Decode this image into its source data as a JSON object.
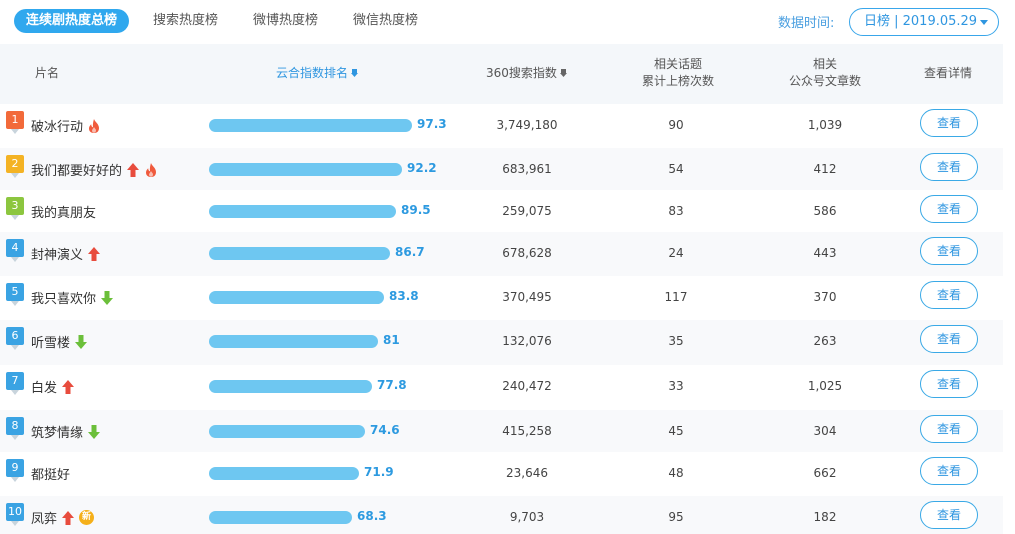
{
  "tabs": [
    {
      "label": "连续剧热度总榜",
      "active": true
    },
    {
      "label": "搜索热度榜",
      "active": false
    },
    {
      "label": "微博热度榜",
      "active": false
    },
    {
      "label": "微信热度榜",
      "active": false
    }
  ],
  "date": {
    "label": "数据时间:",
    "value": "日榜 | 2019.05.29"
  },
  "columns": {
    "title": "片名",
    "cloud_index": "云合指数排名",
    "search_index": "360搜索指数",
    "topics_line1": "相关话题",
    "topics_line2": "累计上榜次数",
    "articles_line1": "相关",
    "articles_line2": "公众号文章数",
    "detail": "查看详情"
  },
  "view_label": "查看",
  "colors": {
    "accent": "#30a8ee",
    "bar": "#6ec7f1",
    "rank1": "#f26a3a",
    "rank2": "#f4b324",
    "rank3": "#8cc63f",
    "rank_other": "#3aa3e3",
    "up": "#e84c3d",
    "down": "#6bbf3a",
    "fire": "#f05a3c"
  },
  "rows": [
    {
      "rank": "1",
      "title": "破冰行动",
      "icons": [
        "fire-icon"
      ],
      "index": "97.3",
      "index_value": 97.3,
      "search": "3,749,180",
      "topics": "90",
      "articles": "1,039"
    },
    {
      "rank": "2",
      "title": "我们都要好好的",
      "icons": [
        "arrow-up-icon",
        "fire-icon"
      ],
      "index": "92.2",
      "index_value": 92.2,
      "search": "683,961",
      "topics": "54",
      "articles": "412"
    },
    {
      "rank": "3",
      "title": "我的真朋友",
      "icons": [],
      "index": "89.5",
      "index_value": 89.5,
      "search": "259,075",
      "topics": "83",
      "articles": "586"
    },
    {
      "rank": "4",
      "title": "封神演义",
      "icons": [
        "arrow-up-icon"
      ],
      "index": "86.7",
      "index_value": 86.7,
      "search": "678,628",
      "topics": "24",
      "articles": "443"
    },
    {
      "rank": "5",
      "title": "我只喜欢你",
      "icons": [
        "arrow-down-icon"
      ],
      "index": "83.8",
      "index_value": 83.8,
      "search": "370,495",
      "topics": "117",
      "articles": "370"
    },
    {
      "rank": "6",
      "title": "听雪楼",
      "icons": [
        "arrow-down-icon"
      ],
      "index": "81",
      "index_value": 81,
      "search": "132,076",
      "topics": "35",
      "articles": "263"
    },
    {
      "rank": "7",
      "title": "白发",
      "icons": [
        "arrow-up-icon"
      ],
      "index": "77.8",
      "index_value": 77.8,
      "search": "240,472",
      "topics": "33",
      "articles": "1,025"
    },
    {
      "rank": "8",
      "title": "筑梦情缘",
      "icons": [
        "arrow-down-icon"
      ],
      "index": "74.6",
      "index_value": 74.6,
      "search": "415,258",
      "topics": "45",
      "articles": "304"
    },
    {
      "rank": "9",
      "title": "都挺好",
      "icons": [],
      "index": "71.9",
      "index_value": 71.9,
      "search": "23,646",
      "topics": "48",
      "articles": "662"
    },
    {
      "rank": "10",
      "title": "凤弈",
      "icons": [
        "arrow-up-icon",
        "new-badge"
      ],
      "badge_new": "新",
      "index": "68.3",
      "index_value": 68.3,
      "search": "9,703",
      "topics": "95",
      "articles": "182"
    }
  ]
}
